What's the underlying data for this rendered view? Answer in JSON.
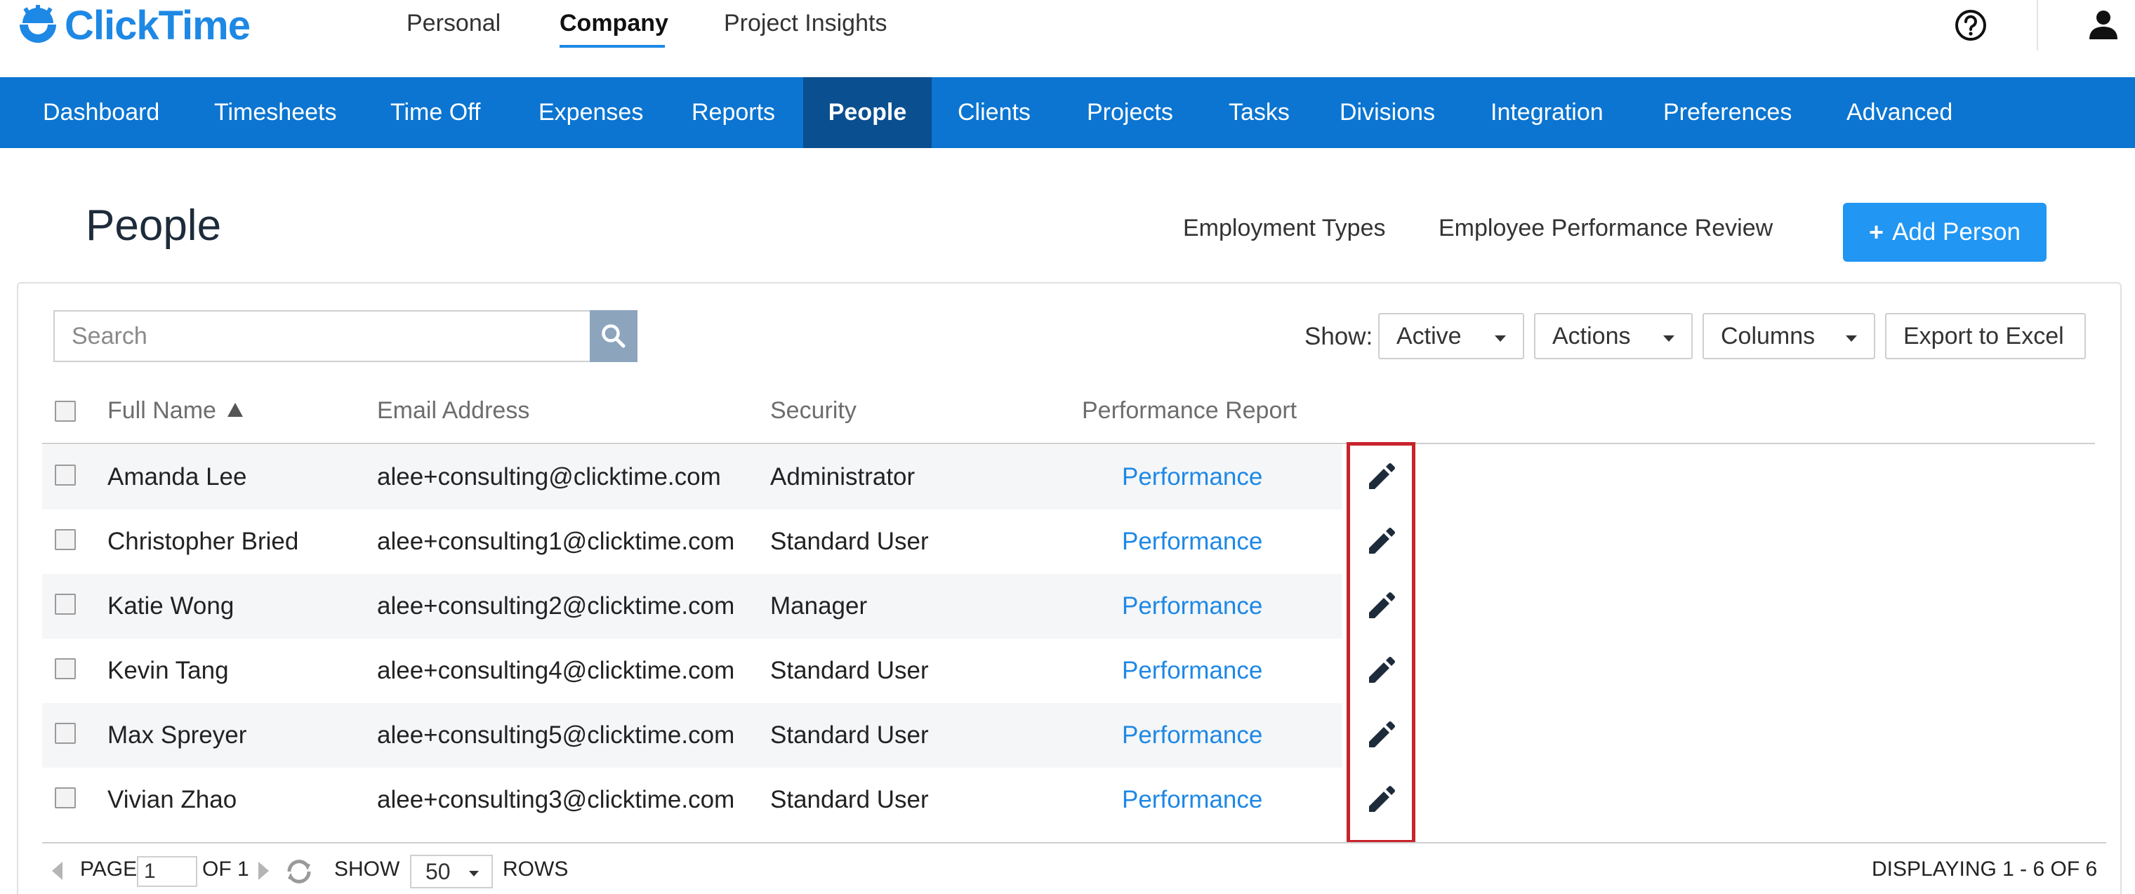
{
  "app": {
    "logo_text": "ClickTime"
  },
  "top_nav": [
    {
      "label": "Personal"
    },
    {
      "label": "Company",
      "active": true
    },
    {
      "label": "Project Insights"
    }
  ],
  "main_nav": [
    {
      "label": "Dashboard"
    },
    {
      "label": "Timesheets"
    },
    {
      "label": "Time Off"
    },
    {
      "label": "Expenses"
    },
    {
      "label": "Reports"
    },
    {
      "label": "People",
      "active": true
    },
    {
      "label": "Clients"
    },
    {
      "label": "Projects"
    },
    {
      "label": "Tasks"
    },
    {
      "label": "Divisions"
    },
    {
      "label": "Integration"
    },
    {
      "label": "Preferences"
    },
    {
      "label": "Advanced"
    }
  ],
  "page": {
    "title": "People",
    "employment_types_label": "Employment Types",
    "performance_review_label": "Employee Performance Review",
    "add_person_label": "Add Person",
    "add_person_plus": "+"
  },
  "toolbar": {
    "search_placeholder": "Search",
    "show_label": "Show:",
    "active_label": "Active",
    "actions_label": "Actions",
    "columns_label": "Columns",
    "export_label": "Export to Excel"
  },
  "table": {
    "headers": {
      "full_name": "Full Name",
      "email": "Email Address",
      "security": "Security",
      "performance": "Performance Report"
    },
    "rows": [
      {
        "name": "Amanda Lee",
        "email": "alee+consulting@clicktime.com",
        "security": "Administrator",
        "performance": "Performance"
      },
      {
        "name": "Christopher Bried",
        "email": "alee+consulting1@clicktime.com",
        "security": "Standard User",
        "performance": "Performance"
      },
      {
        "name": "Katie Wong",
        "email": "alee+consulting2@clicktime.com",
        "security": "Manager",
        "performance": "Performance"
      },
      {
        "name": "Kevin Tang",
        "email": "alee+consulting4@clicktime.com",
        "security": "Standard User",
        "performance": "Performance"
      },
      {
        "name": "Max Spreyer",
        "email": "alee+consulting5@clicktime.com",
        "security": "Standard User",
        "performance": "Performance"
      },
      {
        "name": "Vivian Zhao",
        "email": "alee+consulting3@clicktime.com",
        "security": "Standard User",
        "performance": "Performance"
      }
    ]
  },
  "pager": {
    "page_label": "PAGE",
    "page_value": "1",
    "of_label": "OF 1",
    "show_label": "SHOW",
    "rows_value": "50",
    "rows_label": "ROWS",
    "displaying": "DISPLAYING 1 - 6 OF 6"
  },
  "colors": {
    "brand_blue": "#0b75d1",
    "active_nav": "#0a4f8f",
    "link_blue": "#1e88e5",
    "highlight_red": "#c8232c"
  },
  "icons": [
    "help-icon",
    "user-icon",
    "search-icon",
    "edit-icon",
    "refresh-icon",
    "sort-asc-icon"
  ]
}
